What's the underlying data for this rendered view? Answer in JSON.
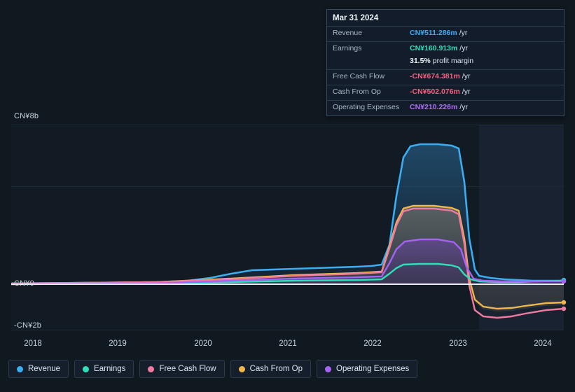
{
  "chart_data": {
    "type": "area",
    "title": "",
    "xlabel": "",
    "ylabel": "",
    "ylim": [
      -2000000000,
      8000000000
    ],
    "y_ticks": [
      {
        "label": "CN¥8b",
        "value": 8000000000
      },
      {
        "label": "CN¥0",
        "value": 0
      },
      {
        "label": "-CN¥2b",
        "value": -2000000000
      }
    ],
    "x_ticks": [
      "2018",
      "2019",
      "2020",
      "2021",
      "2022",
      "2023",
      "2024"
    ],
    "grid": true,
    "legend_position": "bottom",
    "series": [
      {
        "name": "Revenue",
        "color": "#3badf0",
        "x": [
          2018.0,
          2018.5,
          2019.0,
          2019.5,
          2020.0,
          2020.5,
          2021.0,
          2021.25,
          2021.5,
          2021.75,
          2022.0,
          2022.15,
          2022.3,
          2022.5,
          2022.75,
          2023.0,
          2023.1,
          2023.25,
          2023.5,
          2023.75,
          2024.0,
          2024.25
        ],
        "values": [
          40000000,
          50000000,
          60000000,
          70000000,
          90000000,
          180000000,
          420000000,
          520000000,
          560000000,
          570000000,
          640000000,
          3900000000,
          7200000000,
          7250000000,
          7150000000,
          6900000000,
          3000000000,
          700000000,
          420000000,
          430000000,
          480000000,
          511286000
        ]
      },
      {
        "name": "Earnings",
        "color": "#2ee0ba",
        "x": [
          2018.0,
          2019.0,
          2020.0,
          2021.0,
          2022.0,
          2022.3,
          2022.75,
          2023.0,
          2023.25,
          2023.5,
          2024.0,
          2024.25
        ],
        "values": [
          5000000,
          8000000,
          15000000,
          60000000,
          90000000,
          420000000,
          430000000,
          400000000,
          180000000,
          120000000,
          150000000,
          160913000
        ]
      },
      {
        "name": "Free Cash Flow",
        "color": "#f07ba0",
        "x": [
          2018.0,
          2019.0,
          2020.0,
          2021.0,
          2021.75,
          2022.0,
          2022.2,
          2022.4,
          2022.75,
          2023.0,
          2023.15,
          2023.4,
          2023.6,
          2024.0,
          2024.25
        ],
        "values": [
          10000000,
          12000000,
          20000000,
          80000000,
          110000000,
          150000000,
          2700000000,
          4600000000,
          4500000000,
          4100000000,
          300000000,
          -1350000000,
          -1450000000,
          -700000000,
          -674381000
        ]
      },
      {
        "name": "Cash From Op",
        "color": "#f0b84a",
        "x": [
          2018.0,
          2019.0,
          2020.0,
          2021.0,
          2021.75,
          2022.0,
          2022.2,
          2022.4,
          2022.75,
          2023.0,
          2023.15,
          2023.4,
          2023.6,
          2024.0,
          2024.25
        ],
        "values": [
          12000000,
          14000000,
          24000000,
          90000000,
          120000000,
          170000000,
          2800000000,
          4700000000,
          4600000000,
          4200000000,
          350000000,
          -950000000,
          -1050000000,
          -520000000,
          -502076000
        ]
      },
      {
        "name": "Operating Expenses",
        "color": "#a463f2",
        "x": [
          2018.0,
          2019.0,
          2020.0,
          2021.0,
          2021.75,
          2022.0,
          2022.25,
          2022.5,
          2022.75,
          2023.0,
          2023.2,
          2023.5,
          2024.0,
          2024.25
        ],
        "values": [
          8000000,
          10000000,
          18000000,
          60000000,
          80000000,
          110000000,
          1400000000,
          2100000000,
          2150000000,
          1950000000,
          600000000,
          210000000,
          205000000,
          210226000
        ]
      }
    ]
  },
  "tooltip": {
    "title": "Mar 31 2024",
    "rows": [
      {
        "key": "Revenue",
        "value": "CN¥511.286m",
        "unit": "/yr",
        "color": "#3badf0"
      },
      {
        "key": "Earnings",
        "value": "CN¥160.913m",
        "unit": "/yr",
        "color": "#2ee0ba"
      },
      {
        "key": "",
        "value": "31.5%",
        "unit": "profit margin",
        "color": "#eef3f8"
      },
      {
        "key": "Free Cash Flow",
        "value": "-CN¥674.381m",
        "unit": "/yr",
        "color": "#f4607f"
      },
      {
        "key": "Cash From Op",
        "value": "-CN¥502.076m",
        "unit": "/yr",
        "color": "#f4607f"
      },
      {
        "key": "Operating Expenses",
        "value": "CN¥210.226m",
        "unit": "/yr",
        "color": "#b06ef5"
      }
    ]
  },
  "legend": {
    "items": [
      {
        "label": "Revenue",
        "color": "#3badf0"
      },
      {
        "label": "Earnings",
        "color": "#2ee0ba"
      },
      {
        "label": "Free Cash Flow",
        "color": "#f07ba0"
      },
      {
        "label": "Cash From Op",
        "color": "#f0b84a"
      },
      {
        "label": "Operating Expenses",
        "color": "#a463f2"
      }
    ]
  }
}
